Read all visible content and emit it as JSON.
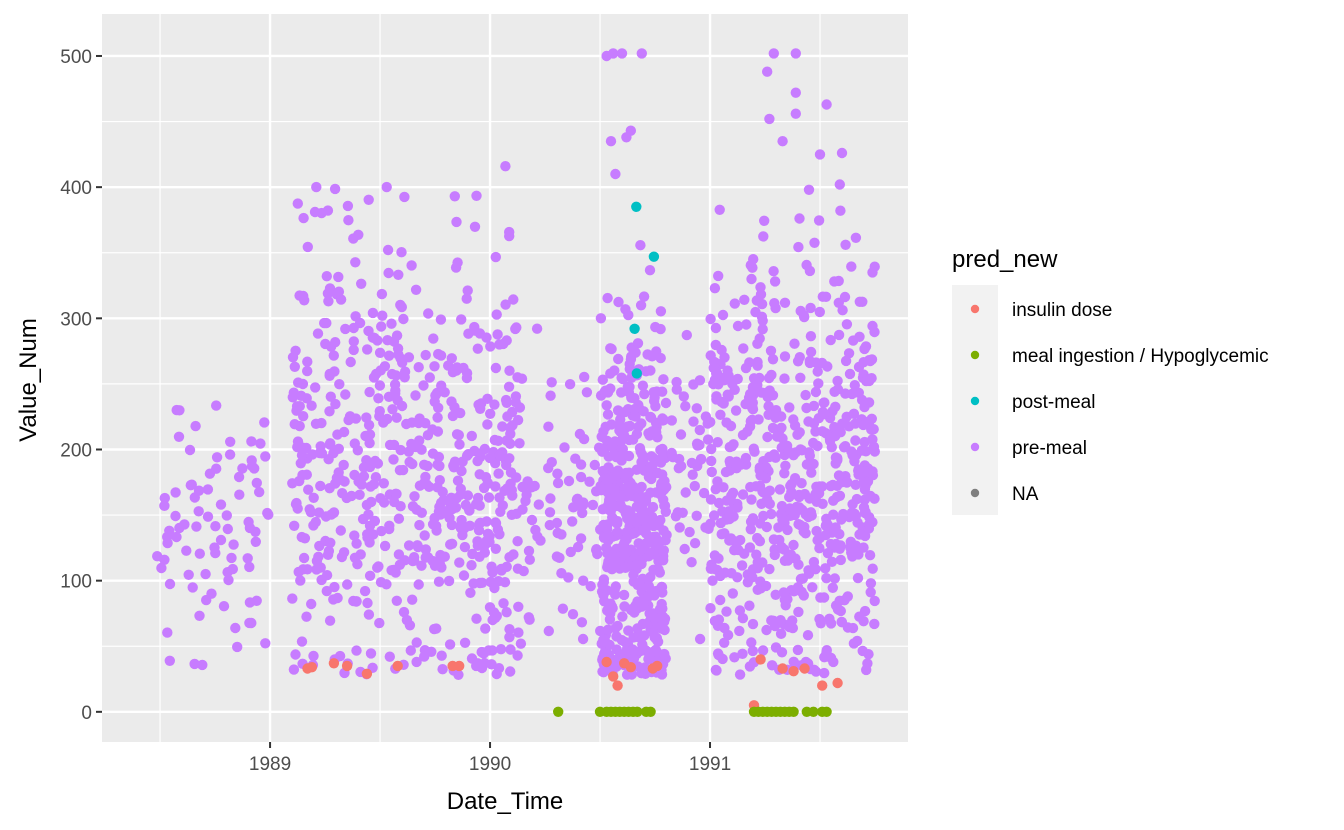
{
  "chart_data": {
    "type": "scatter",
    "title": "",
    "xlabel": "Date_Time",
    "ylabel": "Value_Num",
    "xlim": [
      1988.236,
      1991.9
    ],
    "ylim": [
      -23,
      532
    ],
    "x_ticks": [
      1989,
      1990,
      1991
    ],
    "x_tick_labels": [
      "1989",
      "1990",
      "1991"
    ],
    "x_minor": [
      1988.5,
      1989.5,
      1990.5,
      1991.5
    ],
    "y_ticks": [
      0,
      100,
      200,
      300,
      400,
      500
    ],
    "y_tick_labels": [
      "0",
      "100",
      "200",
      "300",
      "400",
      "500"
    ],
    "y_minor": [
      50,
      150,
      250,
      350,
      450
    ],
    "grid": true,
    "legend": {
      "title": "pred_new",
      "placement": "right",
      "entries": [
        {
          "label": "insulin dose",
          "color": "#F8766D"
        },
        {
          "label": "meal ingestion / Hypoglycemic",
          "color": "#7CAE00"
        },
        {
          "label": "post-meal",
          "color": "#00BFC4"
        },
        {
          "label": "pre-meal",
          "color": "#C77CFF"
        },
        {
          "label": "NA",
          "color": "#7F7F7F"
        }
      ]
    },
    "series": [
      {
        "name": "pre-meal",
        "color": "#C77CFF",
        "clusters": [
          {
            "x_range": [
              1988.48,
              1988.52
            ],
            "y_mean": 120,
            "y_sd": 10,
            "n": 3
          },
          {
            "x_range": [
              1988.48,
              1988.53
            ],
            "y_mean": 165,
            "y_sd": 5,
            "n": 2
          },
          {
            "x_range": [
              1988.53,
              1989.0
            ],
            "y_mean": 150,
            "y_sd": 55,
            "n": 80
          },
          {
            "x_range": [
              1989.1,
              1989.7
            ],
            "y_mean": 190,
            "y_sd": 85,
            "n": 330
          },
          {
            "x_range": [
              1989.7,
              1990.15
            ],
            "y_mean": 170,
            "y_sd": 80,
            "n": 280
          },
          {
            "x_range": [
              1990.15,
              1990.5
            ],
            "y_mean": 150,
            "y_sd": 45,
            "n": 70
          },
          {
            "x_range": [
              1990.5,
              1990.8
            ],
            "y_mean": 140,
            "y_sd": 75,
            "n": 520
          },
          {
            "x_range": [
              1990.8,
              1991.0
            ],
            "y_mean": 175,
            "y_sd": 50,
            "n": 45
          },
          {
            "x_range": [
              1991.0,
              1991.75
            ],
            "y_mean": 170,
            "y_sd": 85,
            "n": 620
          }
        ],
        "points": [
          [
            1990.53,
            500
          ],
          [
            1990.56,
            502
          ],
          [
            1990.6,
            502
          ],
          [
            1990.69,
            502
          ],
          [
            1991.26,
            488
          ],
          [
            1991.29,
            502
          ],
          [
            1991.39,
            502
          ],
          [
            1990.55,
            435
          ],
          [
            1990.62,
            438
          ],
          [
            1990.64,
            443
          ],
          [
            1990.57,
            410
          ],
          [
            1991.27,
            452
          ],
          [
            1991.39,
            472
          ],
          [
            1991.39,
            456
          ],
          [
            1991.53,
            463
          ],
          [
            1990.07,
            416
          ],
          [
            1989.21,
            400
          ],
          [
            1989.53,
            400
          ],
          [
            1989.84,
            393
          ],
          [
            1991.5,
            425
          ],
          [
            1991.33,
            435
          ],
          [
            1991.6,
            426
          ],
          [
            1991.45,
            398
          ],
          [
            1991.59,
            402
          ]
        ]
      },
      {
        "name": "post-meal",
        "color": "#00BFC4",
        "points": [
          [
            1990.665,
            385
          ],
          [
            1990.745,
            347
          ],
          [
            1990.657,
            292
          ],
          [
            1990.667,
            258
          ]
        ]
      },
      {
        "name": "insulin dose",
        "color": "#F8766D",
        "points": [
          [
            1989.17,
            33
          ],
          [
            1989.19,
            34
          ],
          [
            1989.29,
            37
          ],
          [
            1989.35,
            35
          ],
          [
            1989.44,
            29
          ],
          [
            1989.58,
            35
          ],
          [
            1989.83,
            35
          ],
          [
            1989.86,
            35
          ],
          [
            1990.53,
            38
          ],
          [
            1990.56,
            27
          ],
          [
            1990.58,
            20
          ],
          [
            1990.61,
            37
          ],
          [
            1990.64,
            34
          ],
          [
            1990.74,
            33
          ],
          [
            1990.76,
            35
          ],
          [
            1991.2,
            5
          ],
          [
            1991.23,
            40
          ],
          [
            1991.33,
            33
          ],
          [
            1991.38,
            31
          ],
          [
            1991.43,
            33
          ],
          [
            1991.51,
            20
          ],
          [
            1991.58,
            22
          ]
        ]
      },
      {
        "name": "meal ingestion / Hypoglycemic",
        "color": "#7CAE00",
        "points": [
          [
            1990.31,
            0
          ],
          [
            1990.5,
            0
          ],
          [
            1990.53,
            0
          ],
          [
            1990.55,
            0
          ],
          [
            1990.57,
            0
          ],
          [
            1990.59,
            0
          ],
          [
            1990.61,
            0
          ],
          [
            1990.63,
            0
          ],
          [
            1990.65,
            0
          ],
          [
            1990.67,
            0
          ],
          [
            1990.71,
            0
          ],
          [
            1990.73,
            0
          ],
          [
            1991.2,
            0
          ],
          [
            1991.22,
            0
          ],
          [
            1991.24,
            0
          ],
          [
            1991.26,
            0
          ],
          [
            1991.28,
            0
          ],
          [
            1991.3,
            0
          ],
          [
            1991.32,
            0
          ],
          [
            1991.34,
            0
          ],
          [
            1991.36,
            0
          ],
          [
            1991.38,
            0
          ],
          [
            1991.44,
            0
          ],
          [
            1991.47,
            0
          ],
          [
            1991.51,
            0
          ],
          [
            1991.53,
            0
          ]
        ]
      }
    ]
  }
}
